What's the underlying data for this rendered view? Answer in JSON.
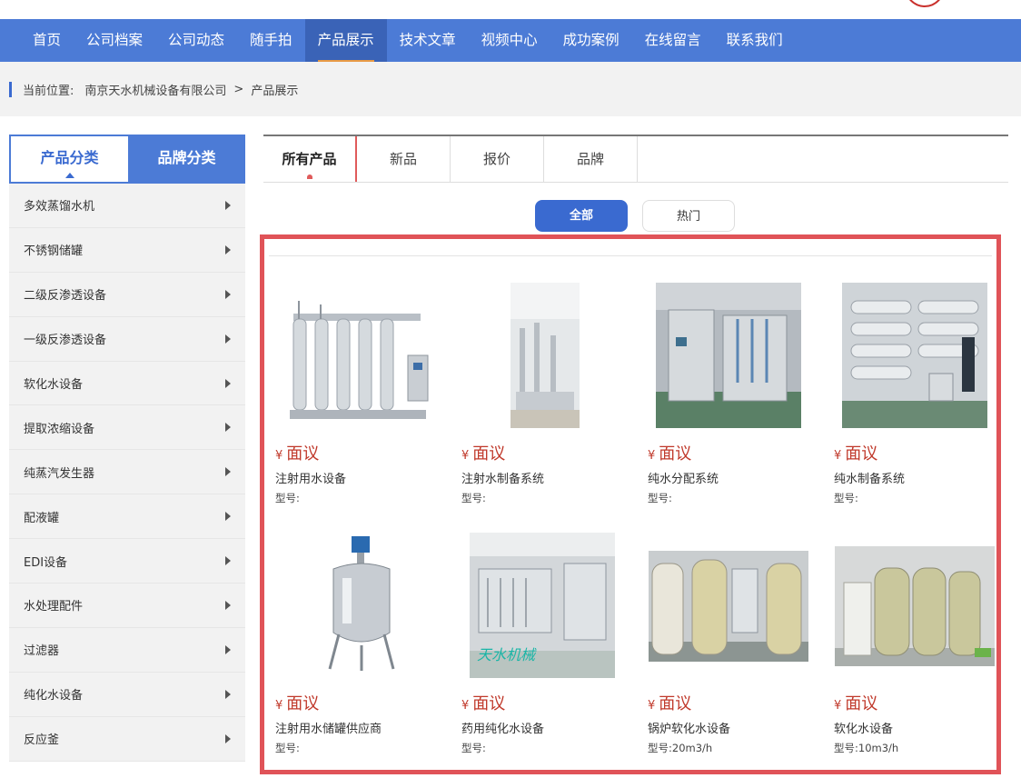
{
  "nav": {
    "items": [
      "首页",
      "公司档案",
      "公司动态",
      "随手拍",
      "产品展示",
      "技术文章",
      "视频中心",
      "成功案例",
      "在线留言",
      "联系我们"
    ],
    "active_index": 4
  },
  "breadcrumb": {
    "label": "当前位置:",
    "home": "南京天水机械设备有限公司",
    "separator": ">",
    "current": "产品展示"
  },
  "sidebar": {
    "tabs": [
      "产品分类",
      "品牌分类"
    ],
    "items": [
      "多效蒸馏水机",
      "不锈钢储罐",
      "二级反渗透设备",
      "一级反渗透设备",
      "软化水设备",
      "提取浓缩设备",
      "纯蒸汽发生器",
      "配液罐",
      "EDI设备",
      "水处理配件",
      "过滤器",
      "纯化水设备",
      "反应釜"
    ]
  },
  "product_tabs": [
    "所有产品",
    "新品",
    "报价",
    "品牌"
  ],
  "filters": {
    "all": "全部",
    "hot": "热门"
  },
  "products": [
    {
      "price_symbol": "¥",
      "price": "面议",
      "name": "注射用水设备",
      "model": "型号:"
    },
    {
      "price_symbol": "¥",
      "price": "面议",
      "name": "注射水制备系统",
      "model": "型号:"
    },
    {
      "price_symbol": "¥",
      "price": "面议",
      "name": "纯水分配系统",
      "model": "型号:"
    },
    {
      "price_symbol": "¥",
      "price": "面议",
      "name": "纯水制备系统",
      "model": "型号:"
    },
    {
      "price_symbol": "¥",
      "price": "面议",
      "name": "注射用水储罐供应商",
      "model": "型号:"
    },
    {
      "price_symbol": "¥",
      "price": "面议",
      "name": "药用纯化水设备",
      "model": "型号:"
    },
    {
      "price_symbol": "¥",
      "price": "面议",
      "name": "锅炉软化水设备",
      "model": "型号:20m3/h"
    },
    {
      "price_symbol": "¥",
      "price": "面议",
      "name": "软化水设备",
      "model": "型号:10m3/h"
    }
  ],
  "image_watermarks": {
    "brand_handwritten": "天水机械"
  },
  "colors": {
    "nav": "#4c7bd6",
    "accent": "#3a6ad0",
    "price": "#c0392b",
    "frame": "#e05358"
  }
}
